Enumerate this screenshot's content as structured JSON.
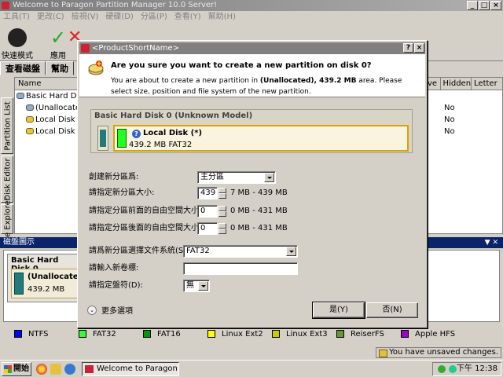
{
  "app": {
    "title": "Welcome to Paragon Partition Manager 10.0 Server!",
    "menu": [
      "工具(T)",
      "更改(C)",
      "檢視(V)",
      "硬碟(D)",
      "分區(P)",
      "查看(Y)",
      "幫助(H)"
    ],
    "toolbar": [
      {
        "label": "快速模式",
        "icon": "express-mode-icon"
      },
      {
        "label": "應用",
        "icon": "apply-checkmark-icon"
      },
      {
        "label": "",
        "icon": "discard-icon"
      }
    ],
    "tabs": [
      "查看磁盤",
      "幫助"
    ],
    "vertical_tabs": [
      "Partition List",
      "Disk Editor",
      "re Explorer"
    ],
    "tree": {
      "header": "Name",
      "items": [
        "Basic Hard Disk",
        "(Unallocated)",
        "Local Disk (",
        "Local Disk ("
      ]
    },
    "columns": {
      "headers": [
        "ve",
        "Hidden",
        "Letter"
      ],
      "rows": [
        "No",
        "No",
        "No"
      ]
    },
    "disk_map": {
      "title": "磁盤圖示",
      "disk_label": "Basic Hard Disk 0",
      "part_name": "(Unallocated)",
      "part_size": "439.2 MB"
    },
    "legend": [
      {
        "name": "NTFS",
        "color": "#0000ff"
      },
      {
        "name": "FAT32",
        "color": "#33ff33"
      },
      {
        "name": "FAT16",
        "color": "#009900"
      },
      {
        "name": "Linux Ext2",
        "color": "#ffff00"
      },
      {
        "name": "Linux Ext3",
        "color": "#cccc00"
      },
      {
        "name": "ReiserFS",
        "color": "#669933"
      },
      {
        "name": "Apple HFS",
        "color": "#9900cc"
      }
    ],
    "status": "You have unsaved changes."
  },
  "dialog": {
    "title": "<ProductShortName>",
    "question": "Are you sure you want to create a new partition on disk 0?",
    "desc_pre": "You are about to create a new partition in ",
    "desc_bold": "(Unallocated), 439.2 MB",
    "desc_post": " area. Please select size, position and file system of the new partition.",
    "disk_title": "Basic Hard Disk 0 (Unknown Model)",
    "partition_name": "Local Disk (*)",
    "partition_info": "439.2 MB FAT32",
    "fields": {
      "create_label": "創建新分區爲:",
      "create_value": "主分區",
      "size_label": "請指定新分區大小:",
      "size_value": "439",
      "size_range": "7 MB - 439 MB",
      "before_label": "請指定分區前面的自由空間大小:",
      "before_value": "0",
      "before_range": "0 MB - 431 MB",
      "after_label": "請指定分區後面的自由空間大小:",
      "after_value": "0",
      "after_range": "0 MB - 431 MB",
      "fs_label": "請爲新分區選擇文件系統(S):",
      "fs_value": "FAT32",
      "volume_label": "請輸入新卷標:",
      "volume_value": "",
      "drive_label": "請指定盤符(D):",
      "drive_value": "無"
    },
    "more_options": "更多選項",
    "yes": "是(Y)",
    "no": "否(N)"
  },
  "taskbar": {
    "start": "開始",
    "task": "Welcome to Paragon Parti...",
    "clock": "下午 12:38"
  }
}
